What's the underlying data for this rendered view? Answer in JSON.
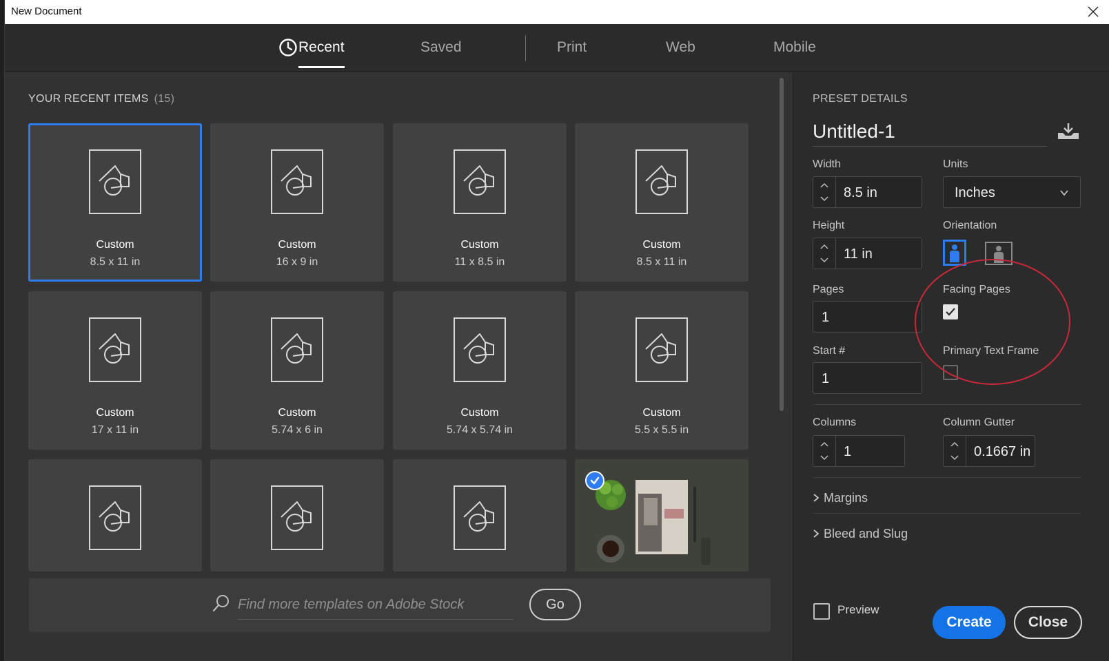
{
  "window": {
    "title": "New Document"
  },
  "tabs": [
    {
      "label": "Recent"
    },
    {
      "label": "Saved"
    },
    {
      "label": "Print"
    },
    {
      "label": "Web"
    },
    {
      "label": "Mobile"
    }
  ],
  "recent": {
    "title": "YOUR RECENT ITEMS",
    "count": "(15)",
    "items": [
      {
        "name": "Custom",
        "size": "8.5 x 11 in"
      },
      {
        "name": "Custom",
        "size": "16 x 9 in"
      },
      {
        "name": "Custom",
        "size": "11 x 8.5 in"
      },
      {
        "name": "Custom",
        "size": "8.5 x 11 in"
      },
      {
        "name": "Custom",
        "size": "17 x 11 in"
      },
      {
        "name": "Custom",
        "size": "5.74 x 6 in"
      },
      {
        "name": "Custom",
        "size": "5.74 x 5.74 in"
      },
      {
        "name": "Custom",
        "size": "5.5 x 5.5 in"
      }
    ]
  },
  "search": {
    "placeholder": "Find more templates on Adobe Stock",
    "go_label": "Go"
  },
  "preset": {
    "title": "PRESET DETAILS",
    "name": "Untitled-1",
    "width_label": "Width",
    "width": "8.5 in",
    "units_label": "Units",
    "units": "Inches",
    "height_label": "Height",
    "height": "11 in",
    "orientation_label": "Orientation",
    "pages_label": "Pages",
    "pages": "1",
    "facing_label": "Facing Pages",
    "start_label": "Start #",
    "start": "1",
    "ptf_label": "Primary Text Frame",
    "columns_label": "Columns",
    "columns": "1",
    "gutter_label": "Column Gutter",
    "gutter": "0.1667 in",
    "margins_label": "Margins",
    "bleed_label": "Bleed and Slug"
  },
  "footer": {
    "preview_label": "Preview",
    "create_label": "Create",
    "close_label": "Close"
  },
  "colors": {
    "accent": "#2d7df0",
    "create": "#1473e6",
    "annotation": "#c8283a"
  }
}
